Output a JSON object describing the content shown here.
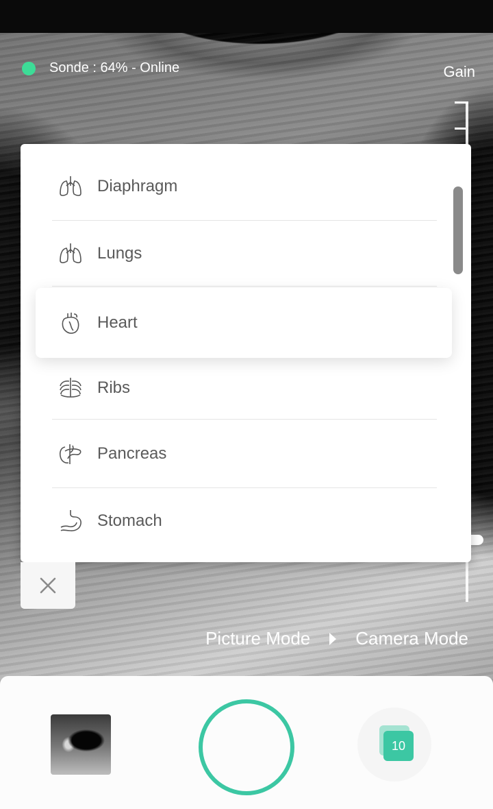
{
  "status": {
    "probe_text": "Sonde : 64% - Online",
    "dot_color": "#3ddc97"
  },
  "gain": {
    "label": "Gain",
    "level": 0.07
  },
  "organ_menu": {
    "items": [
      {
        "label": "Diaphragm",
        "icon": "lungs-icon",
        "selected": false
      },
      {
        "label": "Lungs",
        "icon": "lungs-icon",
        "selected": false
      },
      {
        "label": "Heart",
        "icon": "heart-icon",
        "selected": true
      },
      {
        "label": "Ribs",
        "icon": "ribs-icon",
        "selected": false
      },
      {
        "label": "Pancreas",
        "icon": "pancreas-icon",
        "selected": false
      },
      {
        "label": "Stomach",
        "icon": "stomach-icon",
        "selected": false
      }
    ],
    "close_icon": "close-icon"
  },
  "mode": {
    "picture_label": "Picture Mode",
    "camera_label": "Camera Mode"
  },
  "bottom": {
    "gallery_count": "10",
    "accent_color": "#3cc7a3"
  }
}
